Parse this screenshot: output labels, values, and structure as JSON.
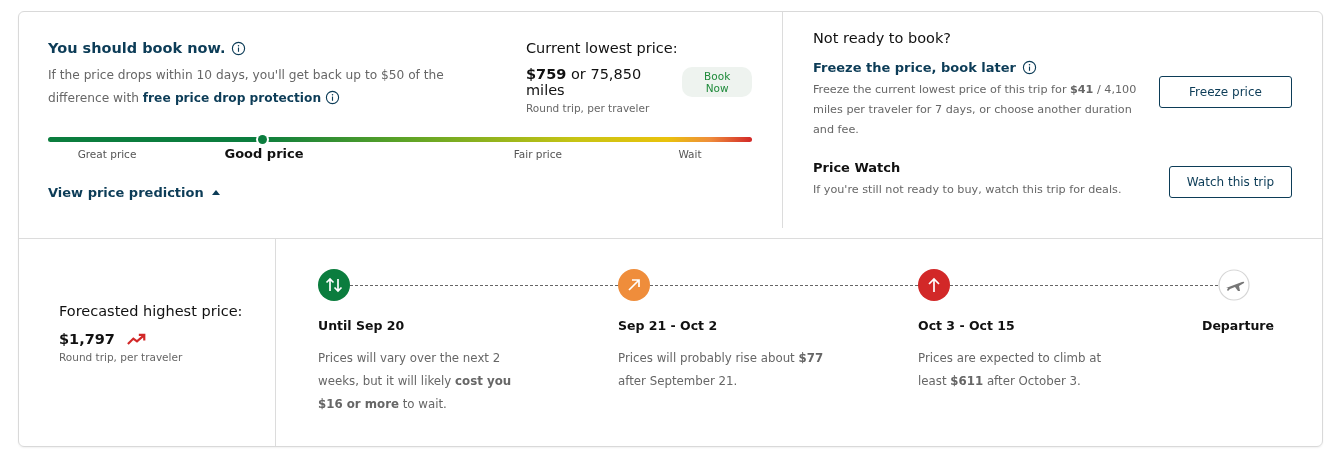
{
  "recommendation": {
    "title": "You should book now.",
    "text": "If the price drops within 10 days, you'll get back up to $50 of the difference with",
    "link": "free price drop protection"
  },
  "current_price": {
    "heading": "Current lowest price:",
    "price": "**$759** or 75,850 miles",
    "badge": "Book Now",
    "note": "Round trip, per traveler"
  },
  "price_meter": {
    "level": 0.305,
    "labels": [
      {
        "label": "Great price",
        "selected": false
      },
      {
        "label": "Good price",
        "selected": true
      },
      {
        "label": "Fair price",
        "selected": false
      },
      {
        "label": "Wait",
        "selected": false
      }
    ]
  },
  "prediction_toggle": {
    "label": "View price prediction",
    "expanded": true
  },
  "not_ready": {
    "heading": "Not ready to book?",
    "freeze": {
      "title": "Freeze the price, book later",
      "text": "Freeze the current lowest price of this trip for **$41** / 4,100 miles per traveler for 7 days, or choose another duration and fee.",
      "button": "Freeze price"
    },
    "watch": {
      "title": "Price Watch",
      "text": "If you're still not ready to buy, watch this trip for deals.",
      "button": "Watch this trip"
    }
  },
  "forecast": {
    "heading": "Forecasted highest price:",
    "price": "$1,797",
    "note": "Round trip, per traveler"
  },
  "timeline": [
    {
      "kind": "vary",
      "color": "#0b7d3e",
      "label": "Until Sep 20",
      "text": "Prices will vary over the next 2 weeks, but it will likely **cost you $16 or more** to wait."
    },
    {
      "kind": "rise",
      "color": "#ef8d3b",
      "label": "Sep 21 - Oct 2",
      "text": "Prices will probably rise about **$77** after September 21."
    },
    {
      "kind": "climb",
      "color": "#d22828",
      "label": "Oct 3 - Oct 15",
      "text": "Prices are expected to climb at least **$611** after October 3."
    },
    {
      "kind": "departure",
      "label": "Departure"
    }
  ]
}
